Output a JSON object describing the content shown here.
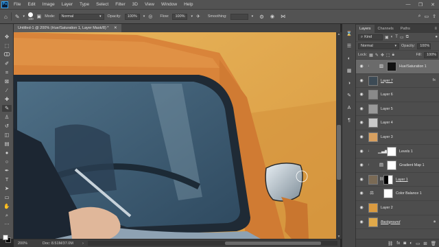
{
  "menubar": {
    "logo": "Ps",
    "items": [
      "File",
      "Edit",
      "Image",
      "Layer",
      "Type",
      "Select",
      "Filter",
      "3D",
      "View",
      "Window",
      "Help"
    ],
    "window_controls": [
      "—",
      "❐",
      "✕"
    ]
  },
  "options": {
    "home_icon": "home-icon",
    "brush_size": "100",
    "mode_label": "Mode:",
    "mode_value": "Normal",
    "opacity_label": "Opacity:",
    "opacity_value": "100%",
    "flow_label": "Flow:",
    "flow_value": "100%",
    "smoothing_label": "Smoothing:",
    "smoothing_value": ""
  },
  "document": {
    "tab_title": "Untitled-1 @ 200% (Hue/Saturation 1, Layer Mask/8) *",
    "zoom": "200%",
    "doc_size": "Doc: 8.51M/37.0M"
  },
  "layers_panel": {
    "tabs": [
      "Layers",
      "Channels",
      "Paths"
    ],
    "filter_kind": "Kind",
    "blend_mode": "Normal",
    "opacity_label": "Opacity:",
    "opacity_value": "100%",
    "lock_label": "Lock:",
    "fill_label": "Fill:",
    "fill_value": "100%",
    "layers": [
      {
        "name": "Hue/Saturation 1",
        "type": "adjustment",
        "selected": true
      },
      {
        "name": "Layer 7",
        "type": "pixel",
        "fx": true
      },
      {
        "name": "Layer 6",
        "type": "pixel"
      },
      {
        "name": "Layer 5",
        "type": "pixel"
      },
      {
        "name": "Layer 4",
        "type": "pixel"
      },
      {
        "name": "Layer 3",
        "type": "pixel"
      },
      {
        "name": "Levels 1",
        "type": "adjustment"
      },
      {
        "name": "Gradient Map 1",
        "type": "adjustment"
      },
      {
        "name": "Layer 1",
        "type": "pixel"
      },
      {
        "name": "Color Balance 1",
        "type": "adjustment"
      },
      {
        "name": "Layer 2",
        "type": "pixel"
      },
      {
        "name": "Background",
        "type": "background"
      }
    ]
  },
  "colors": {
    "accent": "#31a8ff",
    "canvas_bg": "#e3a94e",
    "car_orange": "#d98a38",
    "window_blue": "#3f5b72"
  }
}
